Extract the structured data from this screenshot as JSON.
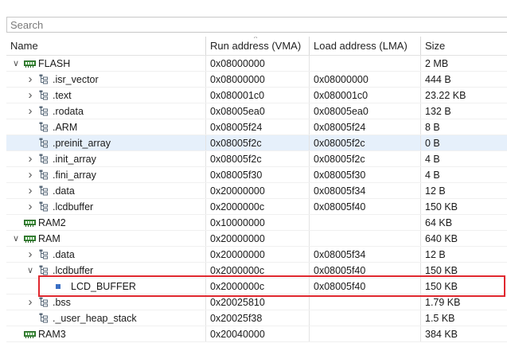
{
  "search": {
    "placeholder": "Search",
    "value": ""
  },
  "columns": {
    "name": "Name",
    "vma": "Run address (VMA)",
    "lma": "Load address (LMA)",
    "size": "Size"
  },
  "rows": [
    {
      "name": "FLASH",
      "vma": "0x08000000",
      "lma": "",
      "size": "2 MB",
      "twisty": "expanded",
      "icon": "memory-region-icon",
      "indent": 0
    },
    {
      "name": ".isr_vector",
      "vma": "0x08000000",
      "lma": "0x08000000",
      "size": "444 B",
      "twisty": "collapsed",
      "icon": "section-icon",
      "indent": 1
    },
    {
      "name": ".text",
      "vma": "0x080001c0",
      "lma": "0x080001c0",
      "size": "23.22 KB",
      "twisty": "collapsed",
      "icon": "section-icon",
      "indent": 1
    },
    {
      "name": ".rodata",
      "vma": "0x08005ea0",
      "lma": "0x08005ea0",
      "size": "132 B",
      "twisty": "collapsed",
      "icon": "section-icon",
      "indent": 1
    },
    {
      "name": ".ARM",
      "vma": "0x08005f24",
      "lma": "0x08005f24",
      "size": "8 B",
      "twisty": "none",
      "icon": "section-icon",
      "indent": 1
    },
    {
      "name": ".preinit_array",
      "vma": "0x08005f2c",
      "lma": "0x08005f2c",
      "size": "0 B",
      "twisty": "none",
      "icon": "section-icon",
      "indent": 1,
      "selected": true
    },
    {
      "name": ".init_array",
      "vma": "0x08005f2c",
      "lma": "0x08005f2c",
      "size": "4 B",
      "twisty": "collapsed",
      "icon": "section-icon",
      "indent": 1
    },
    {
      "name": ".fini_array",
      "vma": "0x08005f30",
      "lma": "0x08005f30",
      "size": "4 B",
      "twisty": "collapsed",
      "icon": "section-icon",
      "indent": 1
    },
    {
      "name": ".data",
      "vma": "0x20000000",
      "lma": "0x08005f34",
      "size": "12 B",
      "twisty": "collapsed",
      "icon": "section-icon",
      "indent": 1
    },
    {
      "name": ".lcdbuffer",
      "vma": "0x2000000c",
      "lma": "0x08005f40",
      "size": "150 KB",
      "twisty": "collapsed",
      "icon": "section-icon",
      "indent": 1
    },
    {
      "name": "RAM2",
      "vma": "0x10000000",
      "lma": "",
      "size": "64 KB",
      "twisty": "none",
      "icon": "memory-region-icon",
      "indent": 0
    },
    {
      "name": "RAM",
      "vma": "0x20000000",
      "lma": "",
      "size": "640 KB",
      "twisty": "expanded",
      "icon": "memory-region-icon",
      "indent": 0
    },
    {
      "name": ".data",
      "vma": "0x20000000",
      "lma": "0x08005f34",
      "size": "12 B",
      "twisty": "collapsed",
      "icon": "section-icon",
      "indent": 1
    },
    {
      "name": ".lcdbuffer",
      "vma": "0x2000000c",
      "lma": "0x08005f40",
      "size": "150 KB",
      "twisty": "expanded",
      "icon": "section-icon",
      "indent": 1
    },
    {
      "name": "LCD_BUFFER",
      "vma": "0x2000000c",
      "lma": "0x08005f40",
      "size": "150 KB",
      "twisty": "none",
      "icon": "symbol-icon",
      "indent": 2
    },
    {
      "name": ".bss",
      "vma": "0x20025810",
      "lma": "",
      "size": "1.79 KB",
      "twisty": "collapsed",
      "icon": "section-icon",
      "indent": 1
    },
    {
      "name": "._user_heap_stack",
      "vma": "0x20025f38",
      "lma": "",
      "size": "1.5 KB",
      "twisty": "none",
      "icon": "section-icon",
      "indent": 1
    },
    {
      "name": "RAM3",
      "vma": "0x20040000",
      "lma": "",
      "size": "384 KB",
      "twisty": "none",
      "icon": "memory-region-icon",
      "indent": 0
    }
  ],
  "colors": {
    "highlight_border": "#e0282f",
    "selected_row": "#e6f0fb",
    "memory_icon": "#3d8f3a",
    "symbol_icon": "#3a6fc4"
  }
}
